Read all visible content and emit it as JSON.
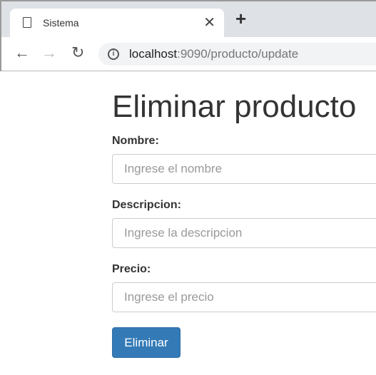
{
  "browser": {
    "tab_title": "Sistema",
    "url_host": "localhost",
    "url_rest": ":9090/producto/update"
  },
  "page": {
    "title": "Eliminar producto",
    "fields": [
      {
        "label": "Nombre:",
        "placeholder": "Ingrese el nombre",
        "value": ""
      },
      {
        "label": "Descripcion:",
        "placeholder": "Ingrese la descripcion",
        "value": ""
      },
      {
        "label": "Precio:",
        "placeholder": "Ingrese el precio",
        "value": ""
      }
    ],
    "submit_label": "Eliminar"
  }
}
